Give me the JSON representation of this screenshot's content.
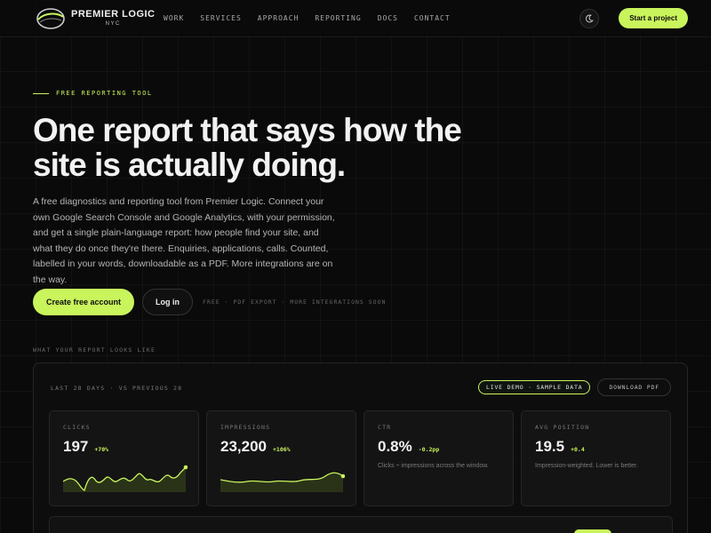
{
  "nav": {
    "logo_name": "PREMIER LOGIC",
    "logo_sub": "NYC",
    "links": [
      "WORK",
      "SERVICES",
      "APPROACH",
      "REPORTING",
      "DOCS",
      "CONTACT"
    ],
    "cta": "Start a project"
  },
  "hero": {
    "eyebrow": "FREE REPORTING TOOL",
    "title": "One report that says how the site is actually doing.",
    "description": "A free diagnostics and reporting tool from Premier Logic. Connect your own Google Search Console and Google Analytics, with your permission, and get a single plain-language report: how people find your site, and what they do once they're there. Enquiries, applications, calls. Counted, labelled in your words, downloadable as a PDF. More integrations are on the way.",
    "create_btn": "Create free account",
    "login_btn": "Log in",
    "note": "FREE · PDF EXPORT · MORE INTEGRATIONS SOON"
  },
  "preview": {
    "section_label": "WHAT YOUR REPORT LOOKS LIKE",
    "period": "LAST 28 DAYS · VS PREVIOUS 28",
    "demo_pill": "LIVE DEMO · SAMPLE DATA",
    "download": "DOWNLOAD PDF",
    "cards": [
      {
        "label": "CLICKS",
        "value": "197",
        "delta": "+70%"
      },
      {
        "label": "IMPRESSIONS",
        "value": "23,200",
        "delta": "+106%"
      },
      {
        "label": "CTR",
        "value": "0.8%",
        "delta": "-0.2pp",
        "note": "Clicks ÷ impressions across the window."
      },
      {
        "label": "AVG POSITION",
        "value": "19.5",
        "delta": "+0.4",
        "note": "Impression-weighted. Lower is better."
      }
    ]
  },
  "colors": {
    "accent": "#c9f45c",
    "background": "#0a0a0a"
  }
}
